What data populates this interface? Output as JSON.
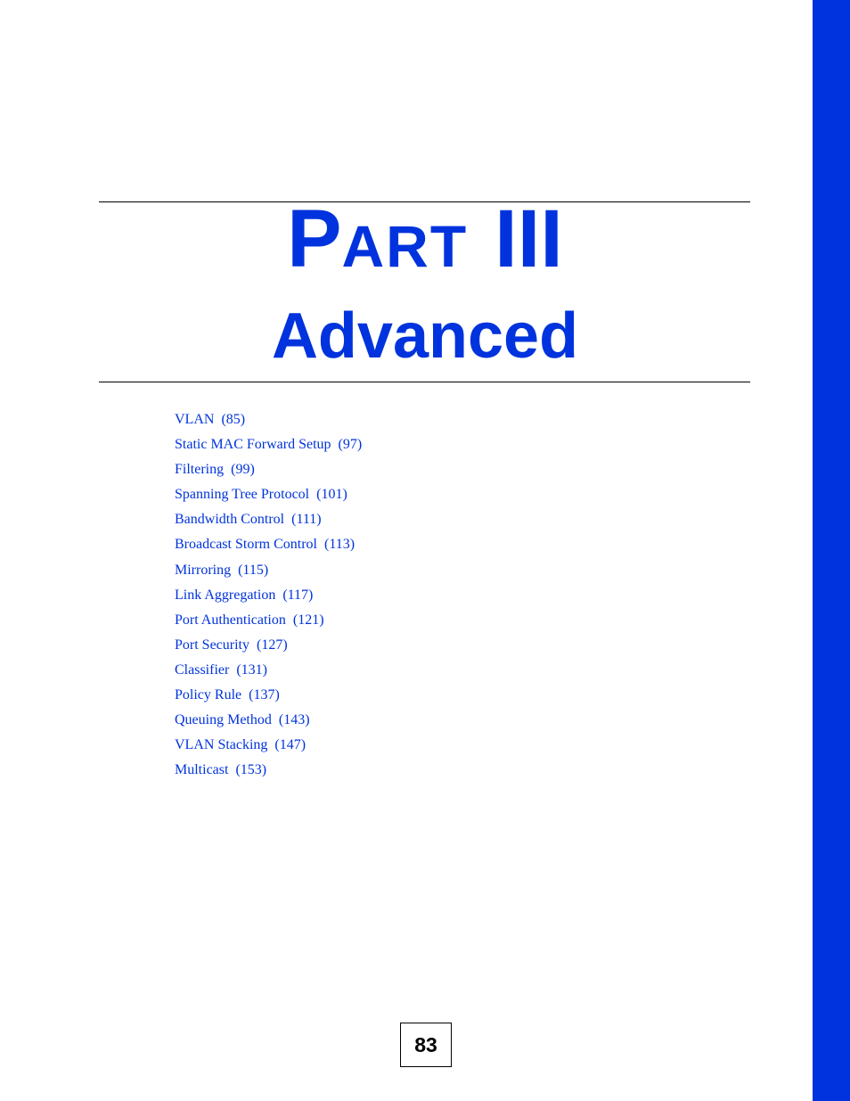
{
  "header": {
    "part_first_letter": "P",
    "part_rest": "ART",
    "part_number": "III",
    "subtitle": "Advanced"
  },
  "toc": {
    "items": [
      {
        "label": "VLAN  (85)"
      },
      {
        "label": "Static MAC Forward Setup  (97)"
      },
      {
        "label": "Filtering  (99)"
      },
      {
        "label": "Spanning Tree Protocol  (101)"
      },
      {
        "label": "Bandwidth Control  (111)"
      },
      {
        "label": "Broadcast Storm Control  (113)"
      },
      {
        "label": "Mirroring  (115)"
      },
      {
        "label": "Link Aggregation  (117)"
      },
      {
        "label": "Port Authentication  (121)"
      },
      {
        "label": "Port Security  (127)"
      },
      {
        "label": "Classifier  (131)"
      },
      {
        "label": "Policy Rule  (137)"
      },
      {
        "label": "Queuing Method  (143)"
      },
      {
        "label": "VLAN Stacking  (147)"
      },
      {
        "label": "Multicast  (153)"
      }
    ]
  },
  "footer": {
    "page_number": "83"
  },
  "colors": {
    "accent": "#0033dd",
    "text": "#000000"
  }
}
